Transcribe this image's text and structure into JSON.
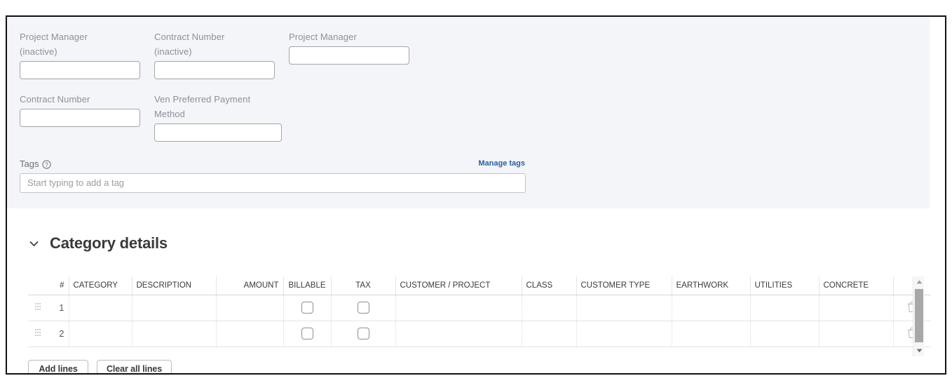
{
  "form": {
    "fields": [
      {
        "label_line1": "Project Manager",
        "label_line2": "(inactive)",
        "value": "",
        "placeholder": ""
      },
      {
        "label_line1": "Contract Number",
        "label_line2": "(inactive)",
        "value": "",
        "placeholder": ""
      },
      {
        "label_line1": "Project Manager",
        "label_line2": "",
        "value": "",
        "placeholder": ""
      },
      {
        "label_line1": "Contract Number",
        "label_line2": "",
        "value": "",
        "placeholder": ""
      },
      {
        "label_line1": "Ven Preferred Payment",
        "label_line2": "Method",
        "value": "",
        "placeholder": ""
      }
    ]
  },
  "tags": {
    "label": "Tags",
    "help_icon": "question-circle-icon",
    "manage_link": "Manage tags",
    "input_value": "",
    "placeholder": "Start typing to add a tag"
  },
  "category_details": {
    "title": "Category details",
    "collapse_icon": "chevron-down-icon",
    "columns": [
      "",
      "#",
      "CATEGORY",
      "DESCRIPTION",
      "AMOUNT",
      "BILLABLE",
      "TAX",
      "CUSTOMER / PROJECT",
      "CLASS",
      "CUSTOMER TYPE",
      "EARTHWORK",
      "UTILITIES",
      "CONCRETE",
      ""
    ],
    "rows": [
      {
        "drag": "drag-handle-icon",
        "num": "1",
        "category": "",
        "description": "",
        "amount": "",
        "billable": false,
        "tax": false,
        "customer_project": "",
        "class": "",
        "customer_type": "",
        "earthwork": "",
        "utilities": "",
        "concrete": "",
        "delete_icon": "trash-icon"
      },
      {
        "drag": "drag-handle-icon",
        "num": "2",
        "category": "",
        "description": "",
        "amount": "",
        "billable": false,
        "tax": false,
        "customer_project": "",
        "class": "",
        "customer_type": "",
        "earthwork": "",
        "utilities": "",
        "concrete": "",
        "delete_icon": "trash-icon"
      }
    ],
    "scrollbar": {
      "up_icon": "triangle-up-icon",
      "down_icon": "triangle-down-icon"
    },
    "buttons": {
      "add_lines": "Add lines",
      "clear_all_lines": "Clear all lines"
    }
  },
  "colors": {
    "panel_bg": "#f4f5f8",
    "link_blue": "#2a60a8",
    "text_dark": "#393a3d",
    "label_gray": "#8d9096",
    "border_gray": "#a3a5a9"
  }
}
